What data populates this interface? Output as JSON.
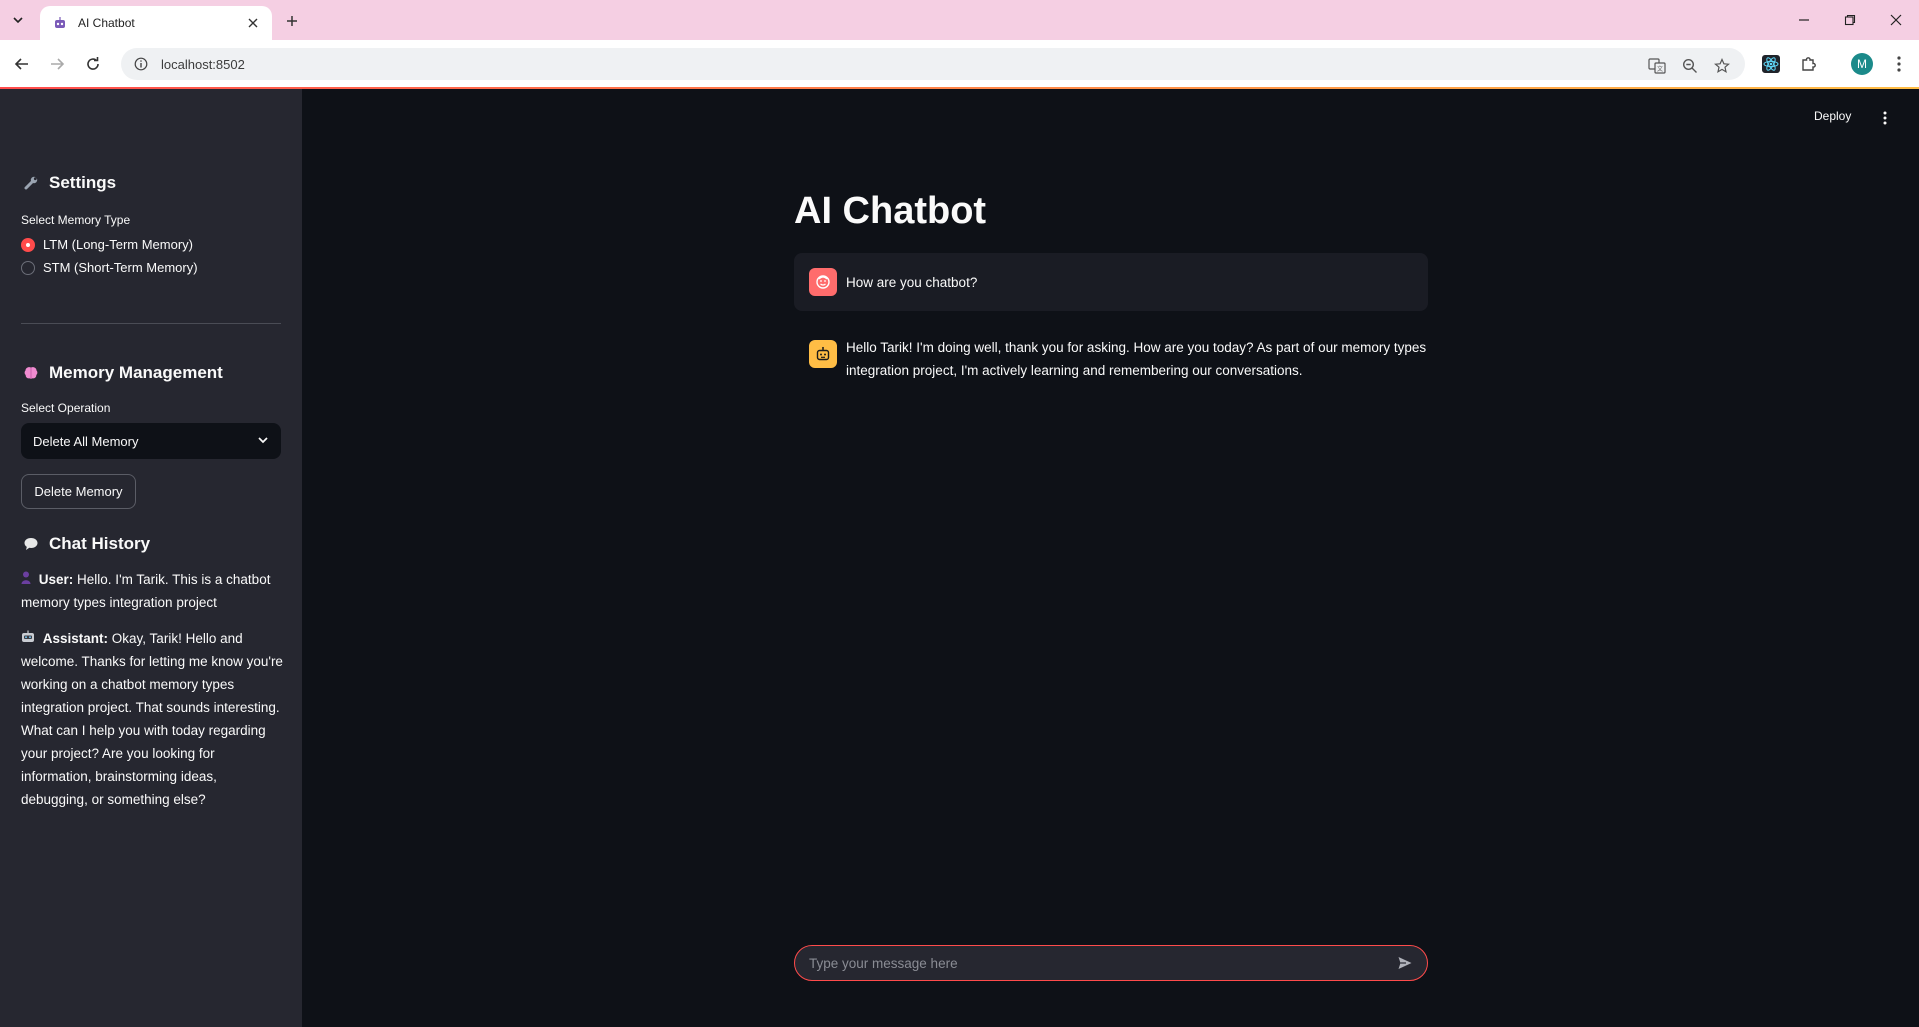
{
  "browser": {
    "tab_title": "AI Chatbot",
    "url": "localhost:8502",
    "avatar_letter": "M"
  },
  "sidebar": {
    "settings_heading": "Settings",
    "settings_icon": "wrench-icon",
    "memory_type_label": "Select Memory Type",
    "memory_options": [
      {
        "label": "LTM (Long-Term Memory)",
        "selected": true
      },
      {
        "label": "STM (Short-Term Memory)",
        "selected": false
      }
    ],
    "memory_mgmt_heading": "Memory Management",
    "memory_mgmt_icon": "brain-icon",
    "operation_label": "Select Operation",
    "operation_selected": "Delete All Memory",
    "delete_button": "Delete Memory",
    "history_heading": "Chat History",
    "history_icon": "speech-bubble-icon",
    "history": [
      {
        "role": "User:",
        "text": "Hello. I'm Tarik. This is a chatbot memory types integration project"
      },
      {
        "role": "Assistant:",
        "text": "Okay, Tarik! Hello and welcome. Thanks for letting me know you're working on a chatbot memory types integration project. That sounds interesting. What can I help you with today regarding your project? Are you looking for information, brainstorming ideas, debugging, or something else?"
      }
    ]
  },
  "main": {
    "deploy_label": "Deploy",
    "title": "AI Chatbot",
    "messages": [
      {
        "role": "user",
        "text": "How are you chatbot?"
      },
      {
        "role": "assistant",
        "text": "Hello Tarik! I'm doing well, thank you for asking. How are you today? As part of our memory types integration project, I'm actively learning and remembering our conversations."
      }
    ],
    "input_placeholder": "Type your message here"
  },
  "colors": {
    "accent": "#ff4b4b",
    "bot_avatar": "#ffbd45",
    "background": "#0e1117",
    "sidebar": "#262730"
  }
}
